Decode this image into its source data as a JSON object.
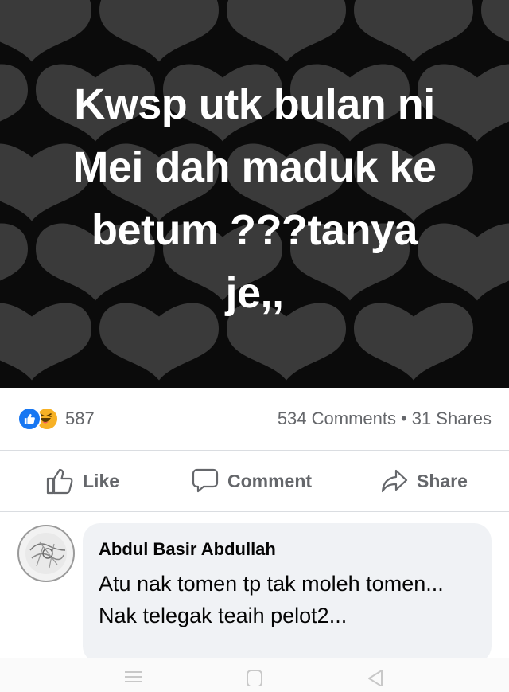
{
  "post": {
    "lines": [
      "Kwsp utk bulan ni",
      "Mei dah maduk ke",
      "betum ???tanya",
      "je,,"
    ]
  },
  "stats": {
    "reaction_count": "587",
    "comments": "534 Comments",
    "separator": "•",
    "shares": "31 Shares"
  },
  "actions": {
    "like": "Like",
    "comment": "Comment",
    "share": "Share"
  },
  "comment": {
    "author": "Abdul Basir Abdullah",
    "text": "Atu nak tomen tp tak moleh tomen... Nak telegak teaih pelot2..."
  },
  "colors": {
    "background_dark": "#0b0b0b",
    "heart": "#3a3a3a",
    "like_blue": "#1877f2",
    "haha_yellow": "#f7b125",
    "muted_text": "#65676b",
    "bubble": "#f0f2f5"
  },
  "icons": {
    "reaction_like": "thumbs-up-icon",
    "reaction_haha": "laughing-face-icon",
    "like": "thumbs-up-outline-icon",
    "comment": "speech-bubble-icon",
    "share": "share-arrow-icon",
    "nav_menu": "recent-apps-icon",
    "nav_home": "home-icon",
    "nav_back": "back-icon"
  }
}
